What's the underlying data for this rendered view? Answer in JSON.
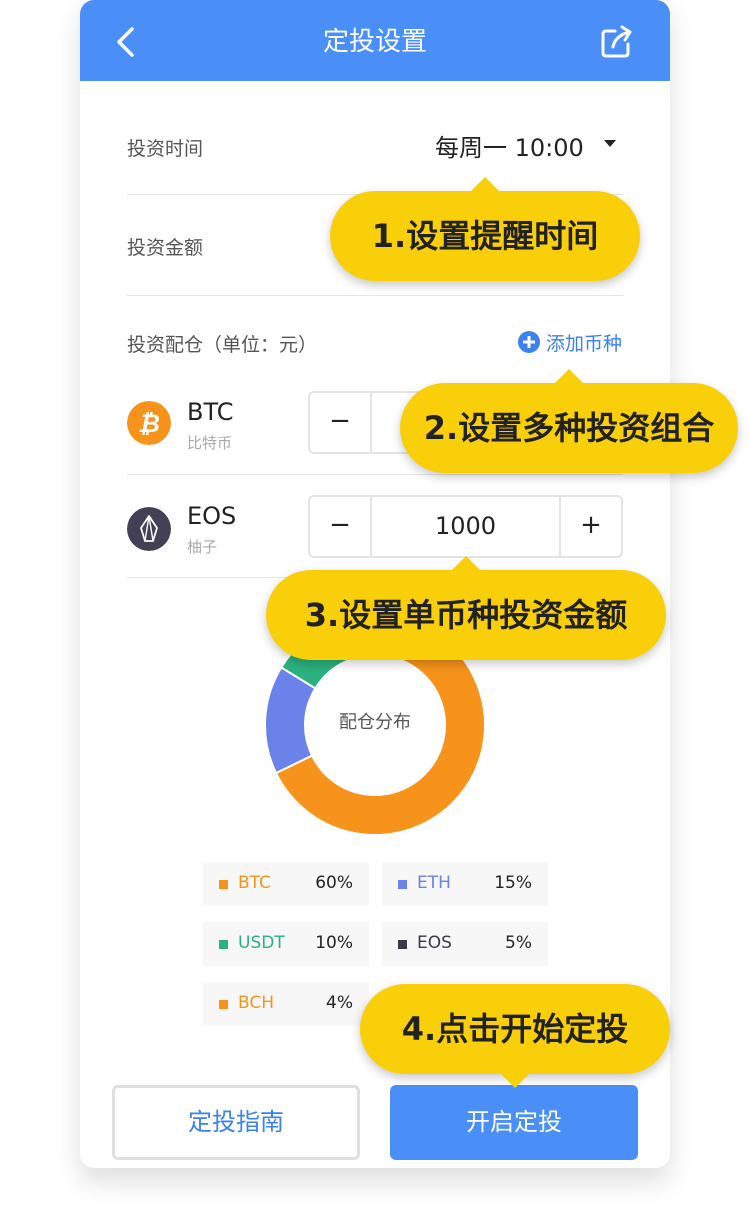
{
  "header": {
    "title": "定投设置",
    "back_icon": "back-arrow-icon",
    "share_icon": "share-icon"
  },
  "settings": {
    "time_label": "投资时间",
    "time_value": "每周一 10:00",
    "amount_label": "投资金额",
    "allocation_label": "投资配仓（单位：元）",
    "add_coin_label": "添加币种"
  },
  "coins": [
    {
      "symbol": "BTC",
      "name": "比特币",
      "minus": "−",
      "plus": "+",
      "value": "",
      "color": "#f7931a"
    },
    {
      "symbol": "EOS",
      "name": "柚子",
      "minus": "−",
      "plus": "+",
      "value": "1000",
      "color": "#433f54"
    }
  ],
  "chart": {
    "center_label": "配仓分布"
  },
  "chart_data": {
    "type": "pie",
    "categories": [
      "BTC",
      "ETH",
      "USDT",
      "EOS",
      "BCH"
    ],
    "values": [
      60,
      15,
      10,
      5,
      4
    ],
    "colors": [
      "#f7931a",
      "#6b82ea",
      "#2bb17f",
      "#3b3849",
      "#f7931a"
    ],
    "value_unit": "%"
  },
  "legend": [
    {
      "name": "BTC",
      "pct": "60%",
      "color": "#f7931a"
    },
    {
      "name": "ETH",
      "pct": "15%",
      "color": "#6b82ea"
    },
    {
      "name": "USDT",
      "pct": "10%",
      "color": "#2bb17f"
    },
    {
      "name": "EOS",
      "pct": "5%",
      "color": "#3b3849"
    },
    {
      "name": "BCH",
      "pct": "4%",
      "color": "#f7931a"
    }
  ],
  "buttons": {
    "guide": "定投指南",
    "start": "开启定投"
  },
  "callouts": [
    "1.设置提醒时间",
    "2.设置多种投资组合",
    "3.设置单币种投资金额",
    "4.点击开始定投"
  ],
  "colors": {
    "primary": "#4a8ef7",
    "callout": "#f9cf0a"
  }
}
